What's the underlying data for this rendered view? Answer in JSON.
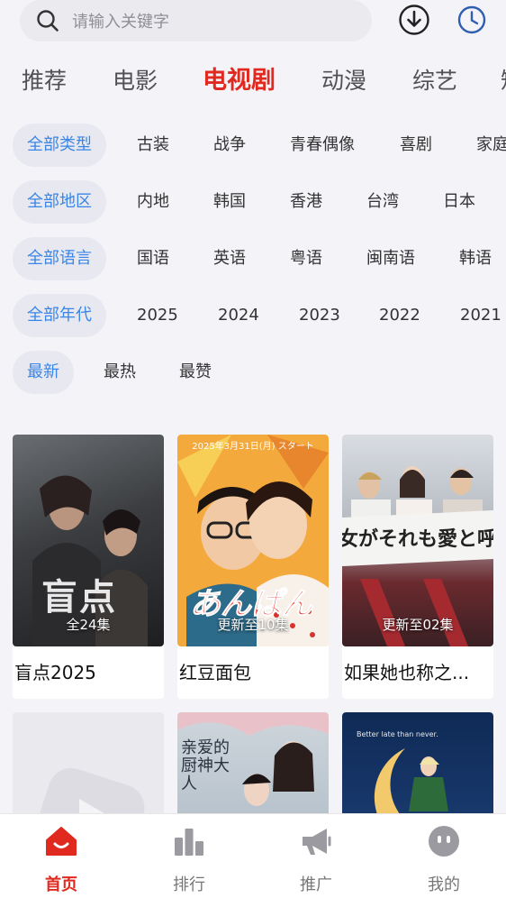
{
  "search": {
    "placeholder": "请输入关键字"
  },
  "tabs": [
    "推荐",
    "电影",
    "电视剧",
    "动漫",
    "综艺",
    "短"
  ],
  "active_tab": "电视剧",
  "filters": {
    "type": [
      "全部类型",
      "古装",
      "战争",
      "青春偶像",
      "喜剧",
      "家庭"
    ],
    "region": [
      "全部地区",
      "内地",
      "韩国",
      "香港",
      "台湾",
      "日本"
    ],
    "language": [
      "全部语言",
      "国语",
      "英语",
      "粤语",
      "闽南语",
      "韩语"
    ],
    "year": [
      "全部年代",
      "2025",
      "2024",
      "2023",
      "2022",
      "2021"
    ],
    "sort": [
      "最新",
      "最热",
      "最赞"
    ]
  },
  "cards": [
    {
      "title": "盲点2025",
      "badge": "全24集",
      "poster_text": "盲点"
    },
    {
      "title": "红豆面包",
      "badge": "更新至10集",
      "poster_text": "あんぱん",
      "poster_top": "2025年3月31日(月) スタート"
    },
    {
      "title": "如果她也称之...",
      "badge": "更新至02集",
      "poster_text": "女がそれも愛と呼"
    },
    {
      "title": "",
      "badge": ""
    },
    {
      "title": "",
      "badge": "",
      "poster_text": "亲爱的厨神大人"
    },
    {
      "title": "",
      "badge": "",
      "poster_text": "Better late than never."
    }
  ],
  "bottom_nav": [
    "首页",
    "排行",
    "推广",
    "我的"
  ],
  "colors": {
    "accent": "#e0291f",
    "selected_chip": "#3a86e8",
    "chip_bg": "#e8e8f0",
    "background": "#f4f3f8"
  }
}
